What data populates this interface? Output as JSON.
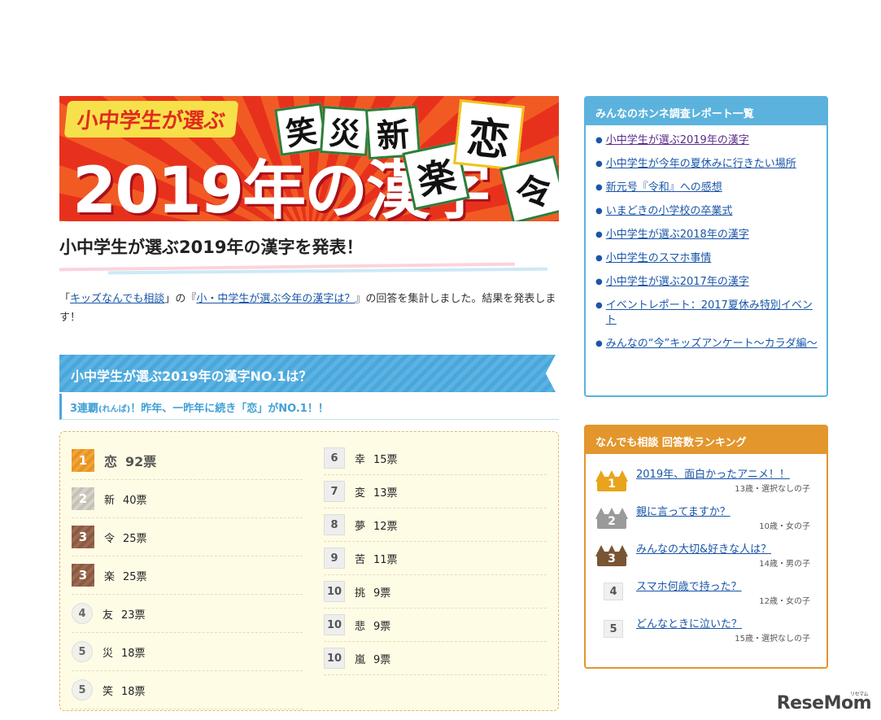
{
  "banner": {
    "tag": "小中学生が選ぶ",
    "headline": "2019年の漢字",
    "tiles": [
      "笑",
      "災",
      "新",
      "楽",
      "恋",
      "令"
    ]
  },
  "page_title": "小中学生が選ぶ2019年の漢字を発表！",
  "intro": {
    "p1": "「",
    "link1": "キッズなんでも相談",
    "p2": "」の『",
    "link2": "小・中学生が選ぶ今年の漢字は？",
    "p3": "』の回答を集計しました。結果を発表します！"
  },
  "section": {
    "heading": "小中学生が選ぶ2019年の漢字NO.1は？",
    "sub_prefix": "3連覇",
    "sub_ruby": "(れんぱ)",
    "sub_rest": "！昨年、一昨年に続き「恋」がNO.1！！"
  },
  "ranking_left": [
    {
      "rank": "1",
      "kanji": "恋",
      "votes": "92票",
      "style": "gold"
    },
    {
      "rank": "2",
      "kanji": "新",
      "votes": "40票",
      "style": "silver"
    },
    {
      "rank": "3",
      "kanji": "令",
      "votes": "25票",
      "style": "bronze"
    },
    {
      "rank": "3",
      "kanji": "楽",
      "votes": "25票",
      "style": "bronze"
    },
    {
      "rank": "4",
      "kanji": "友",
      "votes": "23票",
      "style": "round"
    },
    {
      "rank": "5",
      "kanji": "災",
      "votes": "18票",
      "style": "round"
    },
    {
      "rank": "5",
      "kanji": "笑",
      "votes": "18票",
      "style": "round"
    }
  ],
  "ranking_right": [
    {
      "rank": "6",
      "kanji": "幸",
      "votes": "15票"
    },
    {
      "rank": "7",
      "kanji": "変",
      "votes": "13票"
    },
    {
      "rank": "8",
      "kanji": "夢",
      "votes": "12票"
    },
    {
      "rank": "9",
      "kanji": "苦",
      "votes": "11票"
    },
    {
      "rank": "10",
      "kanji": "挑",
      "votes": "9票"
    },
    {
      "rank": "10",
      "kanji": "悲",
      "votes": "9票"
    },
    {
      "rank": "10",
      "kanji": "嵐",
      "votes": "9票"
    }
  ],
  "reports": {
    "heading": "みんなのホンネ調査レポート一覧",
    "items": [
      "小中学生が選ぶ2019年の漢字",
      "小中学生が今年の夏休みに行きたい場所",
      "新元号『令和』への感想",
      "いまどきの小学校の卒業式",
      "小中学生が選ぶ2018年の漢字",
      "小中学生のスマホ事情",
      "小中学生が選ぶ2017年の漢字",
      "イベントレポート：2017夏休み特別イベント",
      "みんなの“今”キッズアンケート〜カラダ編〜"
    ]
  },
  "answer_ranking": {
    "heading": "なんでも相談 回答数ランキング",
    "items": [
      {
        "rank": "1",
        "title": "2019年、面白かったアニメ！！",
        "meta": "13歳・選択なしの子",
        "crown": "#e8a41c"
      },
      {
        "rank": "2",
        "title": "親に言ってますか？",
        "meta": "10歳・女の子",
        "crown": "#9a9a9a"
      },
      {
        "rank": "3",
        "title": "みんなの大切&好きな人は？",
        "meta": "14歳・男の子",
        "crown": "#7a5534"
      },
      {
        "rank": "4",
        "title": "スマホ何歳で持った？",
        "meta": "12歳・女の子"
      },
      {
        "rank": "5",
        "title": "どんなときに泣いた？",
        "meta": "15歳・選択なしの子"
      }
    ]
  },
  "logo": {
    "text": "ReseMom",
    "small": "リセマム"
  }
}
